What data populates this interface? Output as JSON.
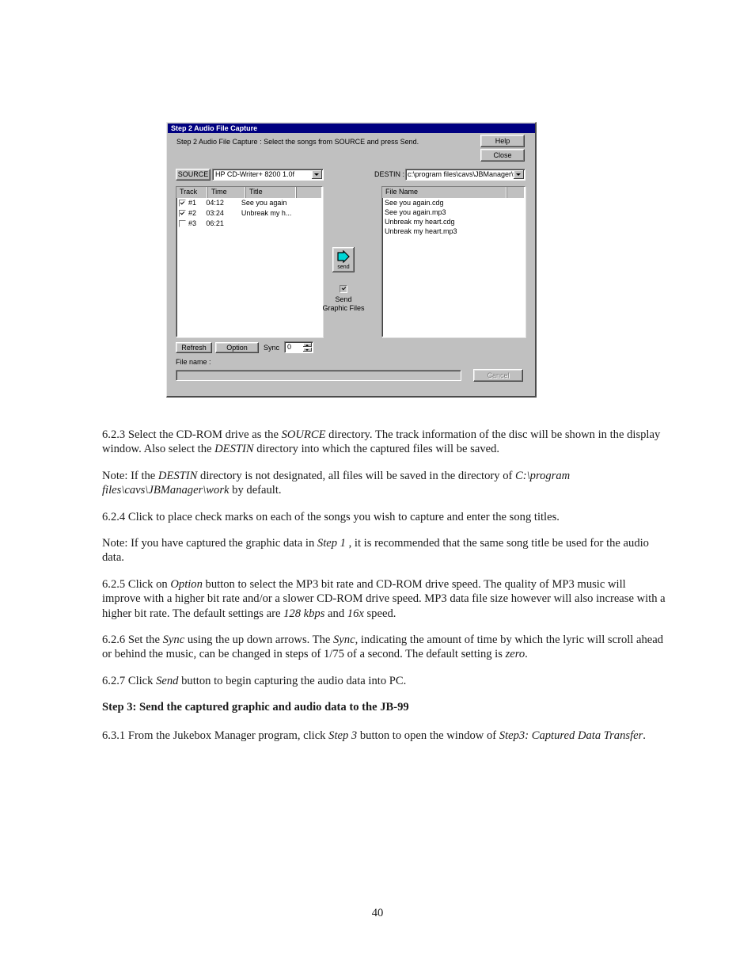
{
  "dialog": {
    "title": "Step 2 Audio File Capture",
    "instruction": "Step 2 Audio File Capture :   Select the songs from SOURCE and press Send.",
    "help_label": "Help",
    "close_label": "Close",
    "source": {
      "button_label": "SOURCE",
      "value": "HP CD-Writer+ 8200 1.0f"
    },
    "destin": {
      "label": "DESTIN :",
      "value": "c:\\program files\\cavs\\JBManager\\w"
    },
    "track_list": {
      "columns": [
        "Track",
        "Time",
        "Title",
        ""
      ],
      "rows": [
        {
          "checked": true,
          "track": "#1",
          "time": "04:12",
          "title": "See you again"
        },
        {
          "checked": true,
          "track": "#2",
          "time": "03:24",
          "title": "Unbreak my h..."
        },
        {
          "checked": false,
          "track": "#3",
          "time": "06:21",
          "title": ""
        }
      ]
    },
    "file_list": {
      "column": "File Name",
      "files": [
        "See you again.cdg",
        "See you again.mp3",
        "Unbreak my heart.cdg",
        "Unbreak my heart.mp3"
      ]
    },
    "send": {
      "label": "send",
      "icon": "right-arrow-icon",
      "arrow_color": "#00d6d6",
      "graphic_checkbox_checked": true,
      "graphic_label": "Send Graphic Files"
    },
    "bottom": {
      "refresh_label": "Refresh",
      "option_label": "Option",
      "sync_label": "Sync",
      "sync_value": "0",
      "filename_label": "File name :",
      "filename_value": "",
      "cancel_label": "Cancel",
      "cancel_disabled": true
    },
    "colors": {
      "titlebar": "#000080",
      "face": "#c0c0c0",
      "accent_arrow": "#00d6d6"
    }
  },
  "document": {
    "paragraphs": [
      {
        "id": "p-623",
        "bold": false,
        "html": "6.2.3 Select the CD-ROM drive as the <span class=\"it\">SOURCE</span> directory.    The track information of the disc will be shown in the display window.    Also select the <span class=\"it\">DESTIN</span> directory into which the captured files will be saved."
      },
      {
        "id": "p-note-destin",
        "bold": false,
        "html": "Note: If the <span class=\"it\">DESTIN</span> directory is not designated, all files will be saved in the directory of <span class=\"it\">C:\\program files\\cavs\\JBManager\\work</span> by default."
      },
      {
        "id": "p-624",
        "bold": false,
        "html": "6.2.4 Click to place check marks on each of the songs you wish to capture and enter the song titles."
      },
      {
        "id": "p-note-step1",
        "bold": false,
        "html": "Note: If you have captured the graphic data in <span class=\"it\">Step 1</span> , it is recommended that the same song title be used for the audio data."
      },
      {
        "id": "p-625",
        "bold": false,
        "html": "6.2.5 Click on <span class=\"it\">Option</span> button to select the MP3 bit rate and CD-ROM drive speed.    The quality of MP3 music will improve with a higher bit rate and/or a slower CD-ROM drive speed.    MP3 data file size however will also increase with a higher bit rate.    The default settings are <span class=\"it\">128 kbps</span> and <span class=\"it\">16x</span> speed."
      },
      {
        "id": "p-626",
        "bold": false,
        "html": "6.2.6 Set the <span class=\"it\">Sync</span> using the up down arrows.    The <span class=\"it\">Sync</span>, indicating the amount of time by which the lyric will scroll ahead or behind the music, can be changed in steps of 1/75 of a second.    The default setting is <span class=\"it\">zero</span>."
      },
      {
        "id": "p-627",
        "bold": false,
        "html": "6.2.7 Click <span class=\"it\">Send</span> button to begin capturing the audio data into PC."
      },
      {
        "id": "p-step3-heading",
        "bold": true,
        "html": "Step 3: Send the captured graphic and audio data to the JB-99"
      },
      {
        "id": "p-631",
        "bold": false,
        "html": "6.3.1 From the Jukebox Manager program, click <span class=\"it\">Step 3</span> button to open the window of <span class=\"it\">Step3: Captured Data Transfer</span>."
      }
    ],
    "page_number": "40"
  }
}
